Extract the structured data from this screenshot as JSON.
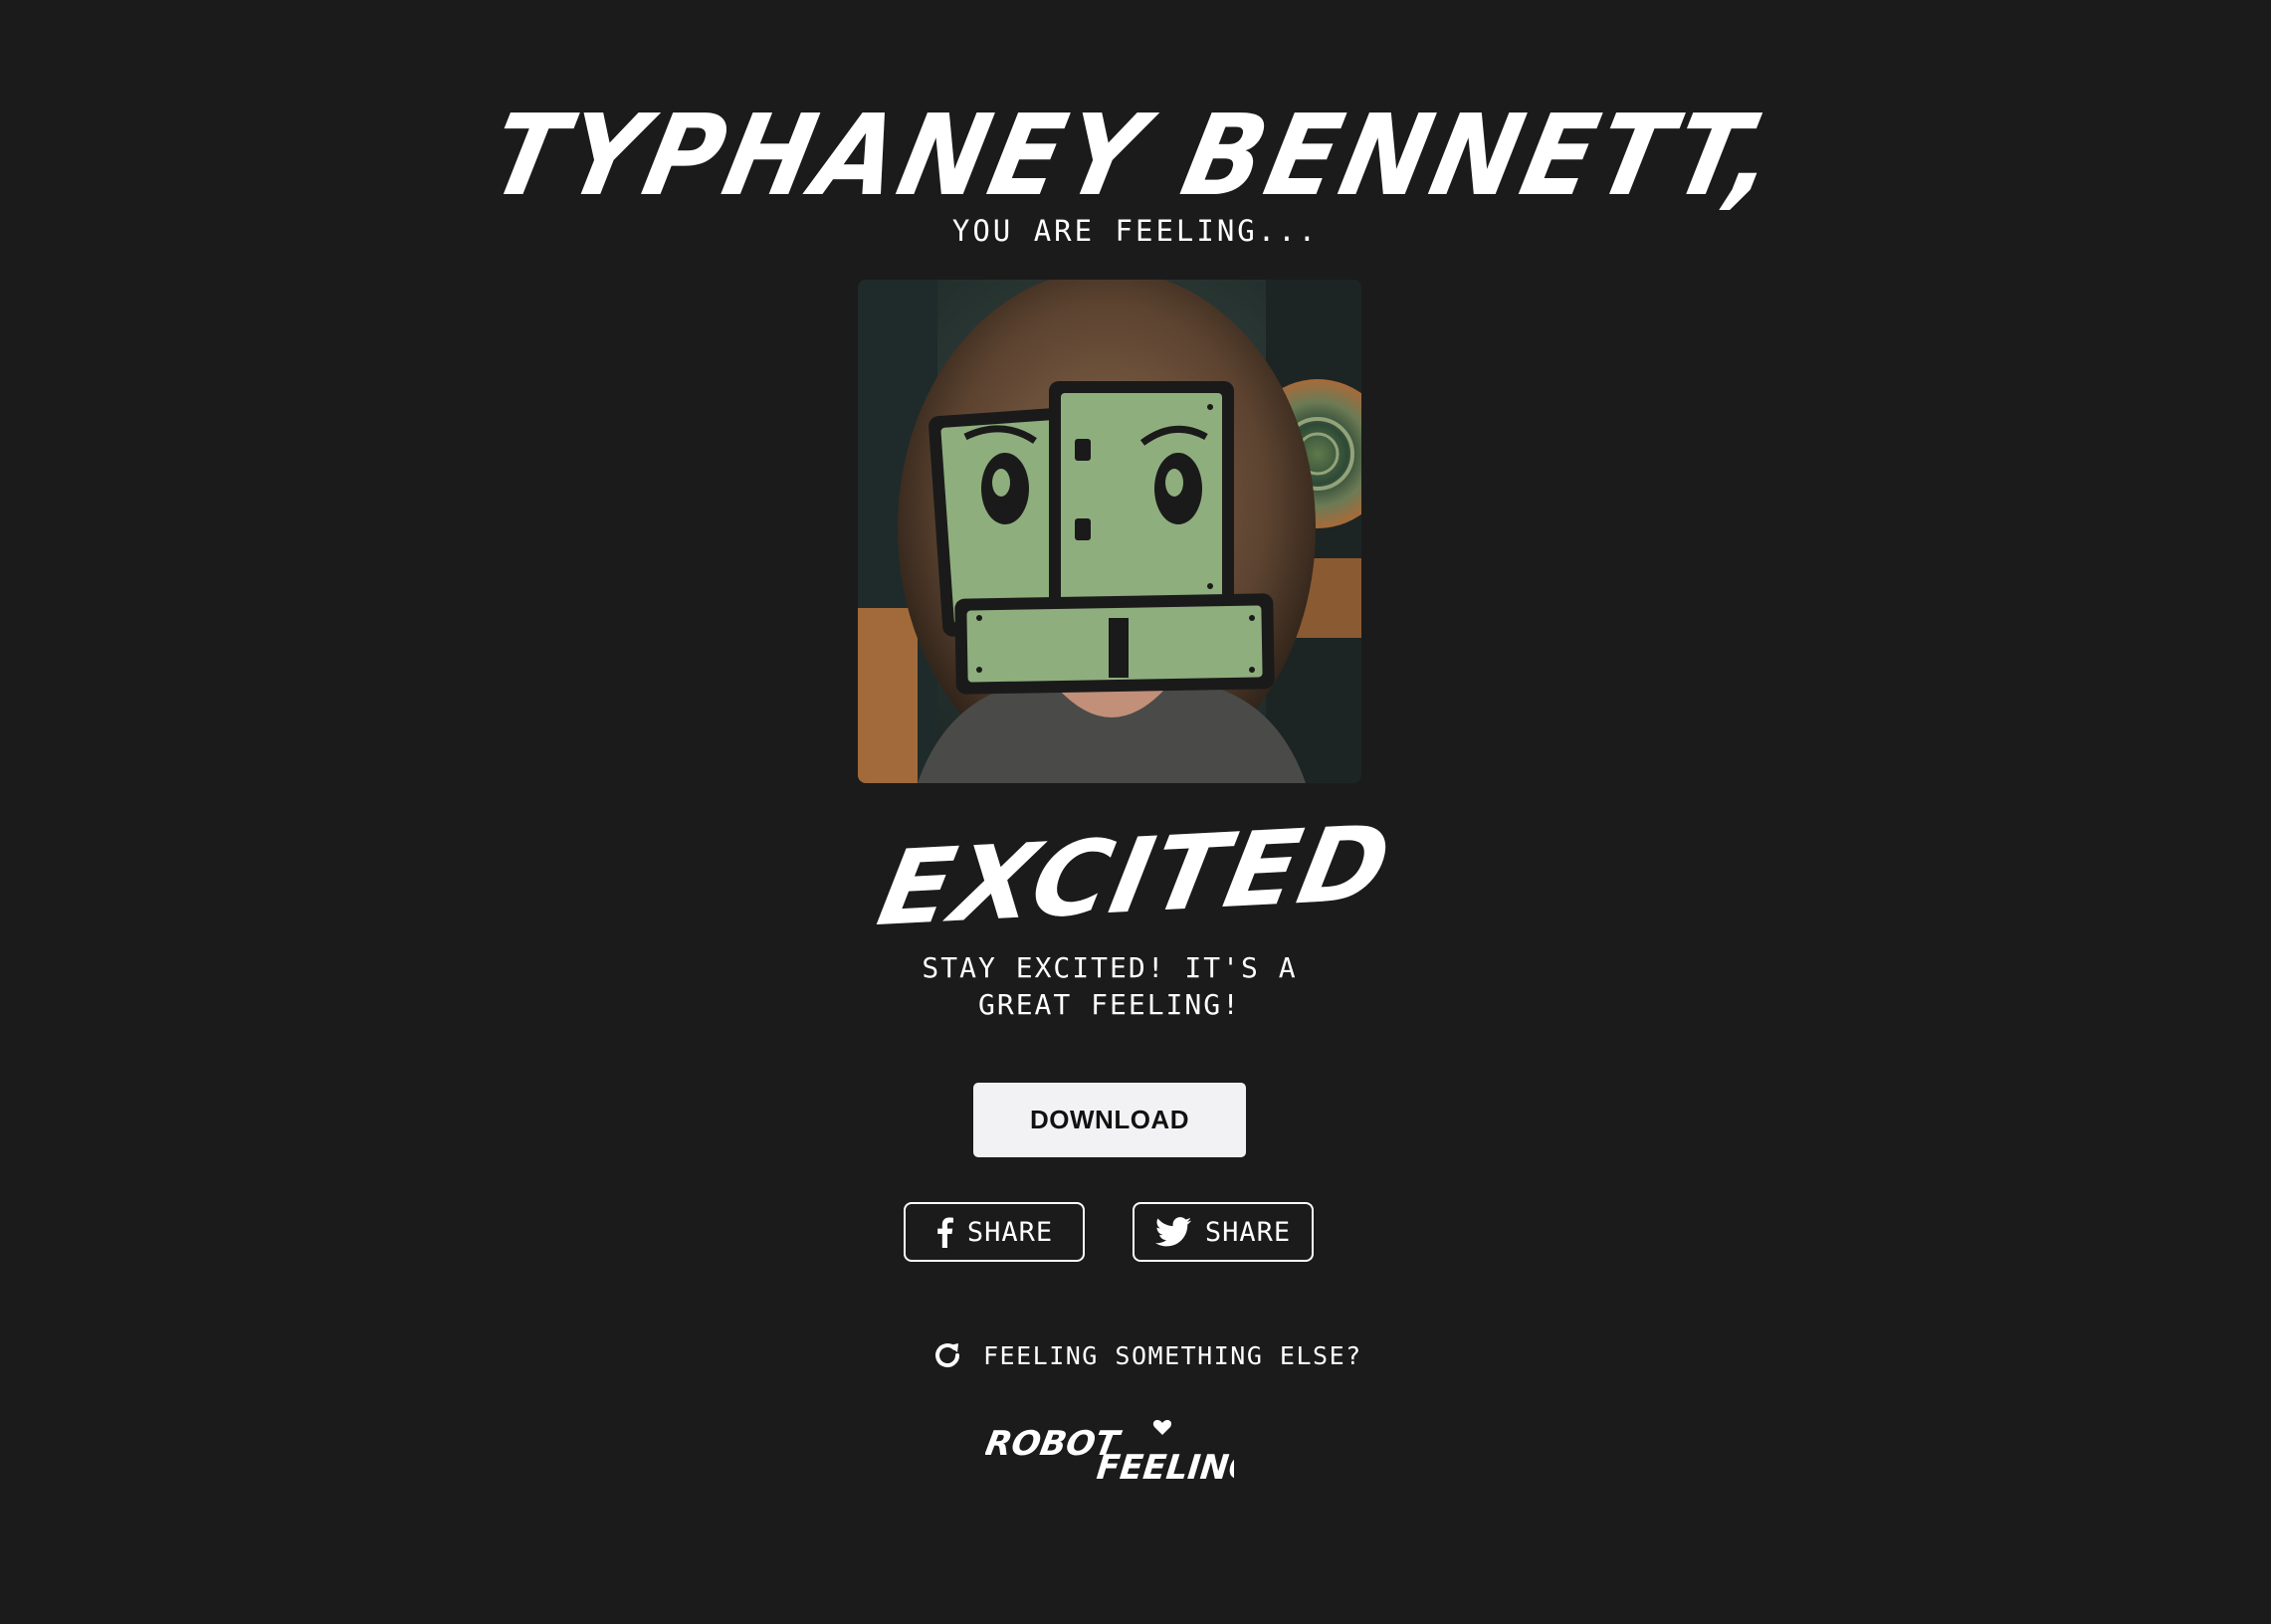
{
  "header": {
    "name": "TYPHANEY BENNETT,",
    "subtitle": "YOU ARE FEELING..."
  },
  "result": {
    "photo_icon": "robot-face-mask-over-person-photo",
    "feeling": "EXCITED",
    "message": "STAY EXCITED! IT'S A GREAT FEELING!"
  },
  "actions": {
    "download_label": "DOWNLOAD",
    "facebook_share_label": "SHARE",
    "twitter_share_label": "SHARE",
    "retry_label": "FEELING SOMETHING ELSE?"
  },
  "brand": {
    "logo_text": "ROBOT FEELINGS"
  },
  "icons": {
    "facebook": "facebook-icon",
    "twitter": "twitter-icon",
    "refresh": "refresh-icon"
  },
  "colors": {
    "background": "#1b1b1b",
    "text": "#ffffff",
    "button_bg": "#f2f2f4",
    "robot_green": "#8fae7e"
  }
}
